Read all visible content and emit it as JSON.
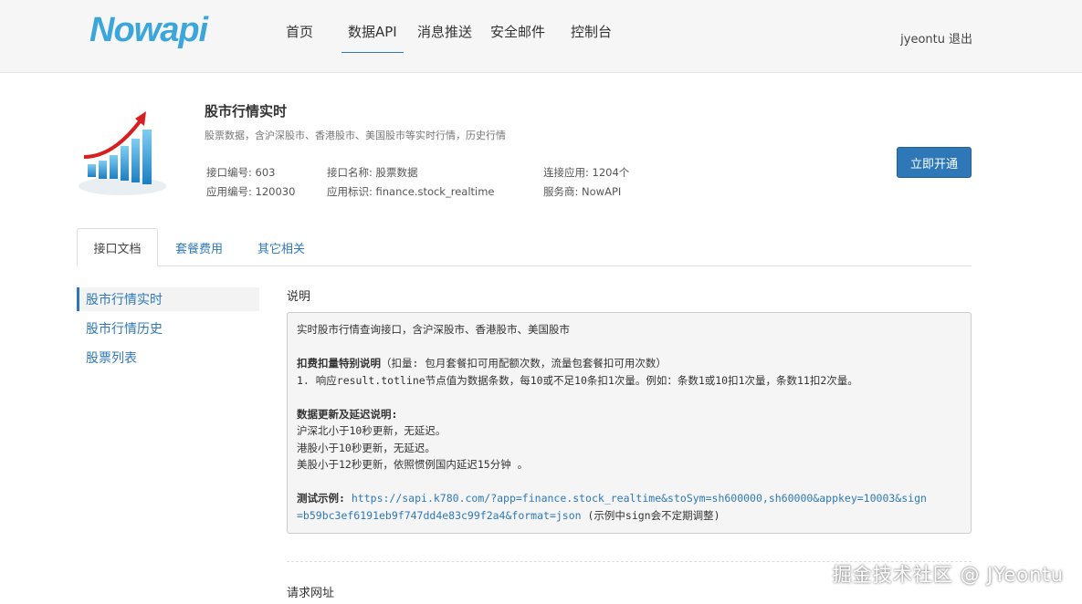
{
  "header": {
    "logo": "Nowapi",
    "nav": [
      "首页",
      "数据API",
      "消息推送",
      "安全邮件",
      "控制台"
    ],
    "active_nav": "数据API",
    "user": "jyeontu",
    "logout": "退出"
  },
  "api": {
    "title": "股市行情实时",
    "desc": "股票数据，含沪深股市、香港股市、美国股市等实时行情，历史行情",
    "id_label": "接口编号: 603",
    "name_label": "接口名称: 股票数据",
    "conn_label": "连接应用: 1204个",
    "app_id_label": "应用编号: 120030",
    "app_tag_label": "应用标识: finance.stock_realtime",
    "provider_label": "服务商: NowAPI",
    "open_button": "立即开通"
  },
  "tabs": [
    "接口文档",
    "套餐费用",
    "其它相关"
  ],
  "sidebar": {
    "items": [
      "股市行情实时",
      "股市行情历史",
      "股票列表"
    ]
  },
  "content": {
    "desc_title": "说明",
    "intro": "实时股市行情查询接口，含沪深股市、香港股市、美国股市",
    "deduct_title": "扣费扣量特别说明",
    "deduct_note": "（扣量: 包月套餐扣可用配额次数，流量包套餐扣可用次数）",
    "deduct_rule": "1. 响应result.totline节点值为数据条数，每10或不足10条扣1次量。例如：条数1或10扣1次量，条数11扣2次量。",
    "update_title": "数据更新及延迟说明:",
    "update_1": "沪深北小于10秒更新，无延迟。",
    "update_2": "港股小于10秒更新，无延迟。",
    "update_3": "美股小于12秒更新，依照惯例国内延迟15分钟 。",
    "test_title": "测试示例:",
    "test_url_1": "https://sapi.k780.com/?app=finance.stock_realtime&stoSym=sh600000,sh60000&appkey=10003&sign",
    "test_url_2": "=b59bc3ef6191eb9f747dd4e83c99f2a4&format=json",
    "test_note": " (示例中sign会不定期调整)",
    "request_title": "请求网址"
  },
  "watermark": "掘金技术社区 @ JYeontu",
  "colors": {
    "accent": "#2e78b8",
    "logo": "#3aa6dc"
  }
}
